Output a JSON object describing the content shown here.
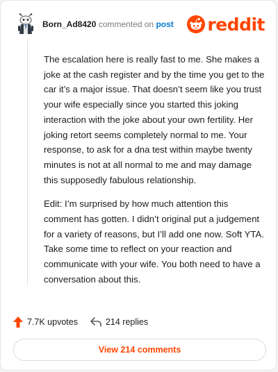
{
  "header": {
    "username": "Born_Ad8420",
    "commented_text": "commented on",
    "post_link": "post",
    "logo_text": "reddit",
    "avatar_icon": "snoo-avatar-icon",
    "logo_icon": "reddit-snoo-icon"
  },
  "comment": {
    "paragraphs": [
      "The escalation here is really fast to me. She makes a joke at the cash register and by the time you get to the car it’s a major issue. That doesn’t seem like you trust your wife especially since you started this joking interaction with the joke about your own fertility. Her joking retort seems completely normal to me. Your response, to ask for a dna test within maybe twenty minutes is not at all normal to me and may damage this supposedly fabulous relationship.",
      "Edit: I’m surprised by how much attention this comment has gotten. I didn’t original put a judgement for a variety of reasons, but I’ll add one now. Soft YTA. Take some time to reflect on your reaction and communicate with your wife. You both need to have a conversation about this."
    ]
  },
  "actions": {
    "upvotes": "7.7K upvotes",
    "replies": "214 replies",
    "upvote_icon": "upvote-arrow-icon",
    "reply_icon": "reply-arrow-icon"
  },
  "view_button": "View 214 comments",
  "colors": {
    "brand": "#ff4500",
    "link": "#0079d3",
    "muted": "#7c7c7c"
  }
}
